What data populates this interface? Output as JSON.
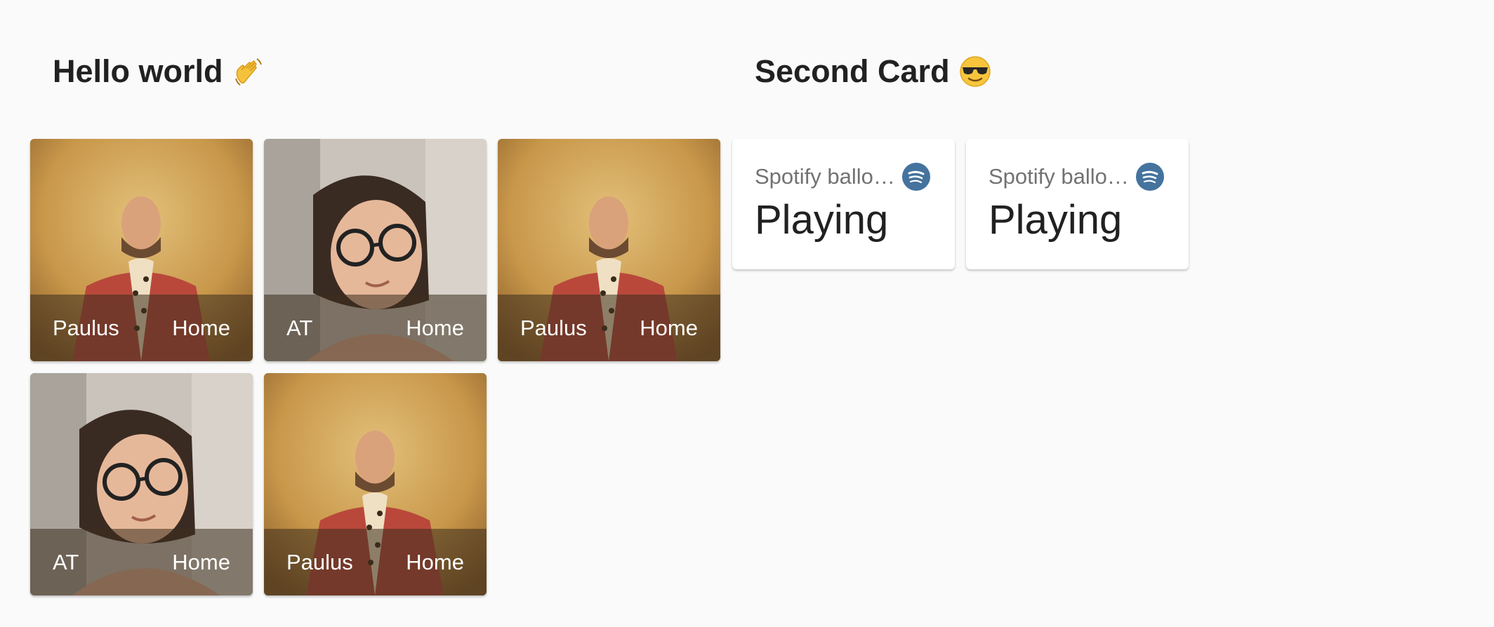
{
  "left_card": {
    "title": "Hello world",
    "title_emoji": "waving-hand-emoji",
    "tiles": [
      {
        "person": "Paulus",
        "state": "Home",
        "avatar": "paulus-portrait"
      },
      {
        "person": "AT",
        "state": "Home",
        "avatar": "at-portrait"
      },
      {
        "person": "Paulus",
        "state": "Home",
        "avatar": "paulus-portrait"
      },
      {
        "person": "AT",
        "state": "Home",
        "avatar": "at-portrait"
      },
      {
        "person": "Paulus",
        "state": "Home",
        "avatar": "paulus-portrait"
      }
    ]
  },
  "right_card": {
    "title": "Second Card",
    "title_emoji": "sunglasses-emoji",
    "media": [
      {
        "entity": "Spotify ballo…",
        "state": "Playing",
        "icon": "spotify-icon"
      },
      {
        "entity": "Spotify ballo…",
        "state": "Playing",
        "icon": "spotify-icon"
      }
    ]
  },
  "colors": {
    "background": "#fafafa",
    "card": "#ffffff",
    "spotify_badge": "#44739e",
    "primary_text": "#212121",
    "secondary_text": "#727272"
  }
}
